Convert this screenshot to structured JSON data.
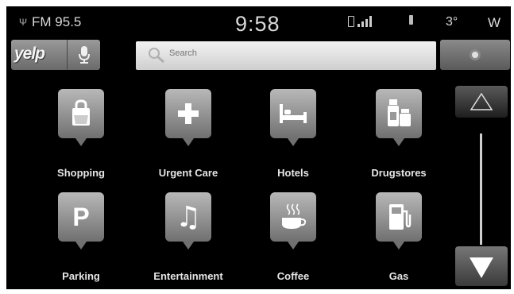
{
  "status": {
    "radio": "FM 95.5",
    "time": "9:58",
    "temperature": "3°",
    "heading": "W"
  },
  "toolbar": {
    "brand": "yelp",
    "search_placeholder": "Search"
  },
  "categories": [
    {
      "label": "Shopping",
      "icon": "shopping-bag-icon"
    },
    {
      "label": "Urgent Care",
      "icon": "medical-cross-icon"
    },
    {
      "label": "Hotels",
      "icon": "hotel-bed-icon"
    },
    {
      "label": "Drugstores",
      "icon": "pill-bottle-icon"
    },
    {
      "label": "Parking",
      "icon": "parking-icon"
    },
    {
      "label": "Entertainment",
      "icon": "music-note-icon"
    },
    {
      "label": "Coffee",
      "icon": "coffee-cup-icon"
    },
    {
      "label": "Gas",
      "icon": "gas-pump-icon"
    }
  ],
  "colors": {
    "screen_bg": "#000000",
    "tile": "#a0a0a0",
    "text": "#e6e6e6"
  }
}
